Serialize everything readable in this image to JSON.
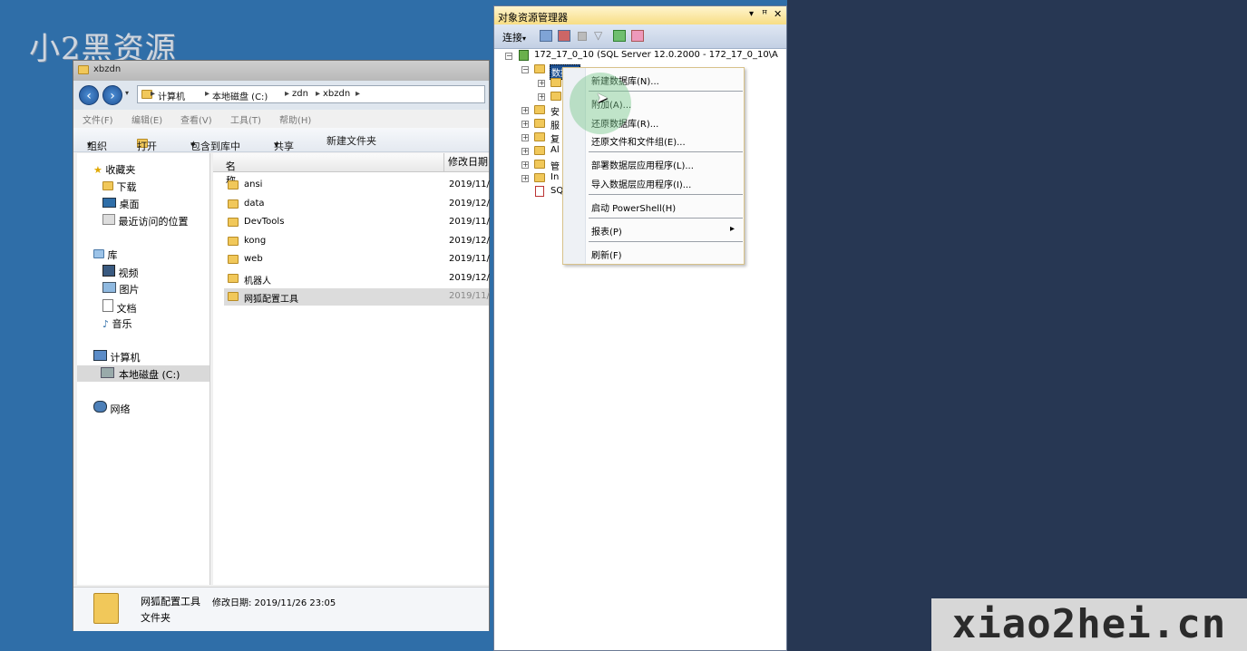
{
  "desktop": {
    "watermark_top": "小2黑资源",
    "watermark_bottom": "xiao2hei.cn"
  },
  "explorer": {
    "title": "xbzdn",
    "breadcrumbs": [
      "计算机",
      "本地磁盘 (C:)",
      "zdn",
      "xbzdn"
    ],
    "menu": [
      "文件(F)",
      "编辑(E)",
      "查看(V)",
      "工具(T)",
      "帮助(H)"
    ],
    "toolbar": {
      "organize": "组织",
      "open": "打开",
      "include": "包含到库中",
      "share": "共享",
      "new_folder": "新建文件夹"
    },
    "nav": {
      "favorites": "收藏夹",
      "downloads": "下载",
      "desktop": "桌面",
      "recent": "最近访问的位置",
      "libraries": "库",
      "videos": "视频",
      "pictures": "图片",
      "documents": "文档",
      "music": "音乐",
      "computer": "计算机",
      "local_disk": "本地磁盘 (C:)",
      "network": "网络"
    },
    "columns": {
      "name": "名称",
      "modified": "修改日期"
    },
    "rows": [
      {
        "name": "ansi",
        "date": "2019/11/"
      },
      {
        "name": "data",
        "date": "2019/12/"
      },
      {
        "name": "DevTools",
        "date": "2019/11/"
      },
      {
        "name": "kong",
        "date": "2019/12/"
      },
      {
        "name": "web",
        "date": "2019/11/"
      },
      {
        "name": "机器人",
        "date": "2019/12/"
      },
      {
        "name": "网狐配置工具",
        "date": "2019/11/"
      }
    ],
    "status": {
      "name": "网狐配置工具",
      "modified": "修改日期: 2019/11/26 23:05",
      "type": "文件夹"
    }
  },
  "ssms": {
    "title": "对象资源管理器",
    "title_controls": "▾ ⅹ ✕",
    "connect": "连接",
    "server": "172_17_0_10 (SQL Server 12.0.2000 - 172_17_0_10\\A",
    "tree": [
      "数据库",
      "安",
      "服",
      "复",
      "Al",
      "管",
      "In",
      "SQ"
    ]
  },
  "context_menu": {
    "items": [
      "新建数据库(N)...",
      "附加(A)...",
      "还原数据库(R)...",
      "还原文件和文件组(E)...",
      "部署数据层应用程序(L)...",
      "导入数据层应用程序(I)...",
      "启动 PowerShell(H)",
      "报表(P)",
      "刷新(F)"
    ],
    "submenu_arrow": "▸"
  },
  "colors": {
    "desktop_blue": "#2f6ea8",
    "dark_navy": "#273753",
    "menu_border": "#d8c28a"
  }
}
